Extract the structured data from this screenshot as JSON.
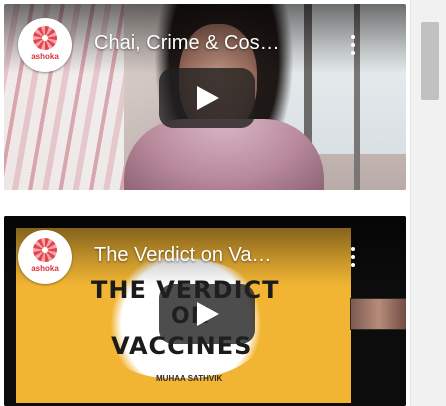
{
  "videos": [
    {
      "title": "Chai, Crime & Cos…",
      "channel_brand": "ashoka",
      "play_icon": "play-icon",
      "menu_icon": "more-vertical-icon"
    },
    {
      "title": "The Verdict on Va…",
      "channel_brand": "ashoka",
      "poster": {
        "line1": "THE VERDICT",
        "line2": "ON",
        "line3": "VACCINES",
        "subtitle": "MUHAA SATHVIK"
      },
      "play_icon": "play-icon",
      "menu_icon": "more-vertical-icon"
    }
  ],
  "colors": {
    "poster_yellow": "#f2b533",
    "brand_red": "#d7343d",
    "scrollbar_track": "#f1f1f1",
    "scrollbar_thumb": "#c1c1c1"
  }
}
